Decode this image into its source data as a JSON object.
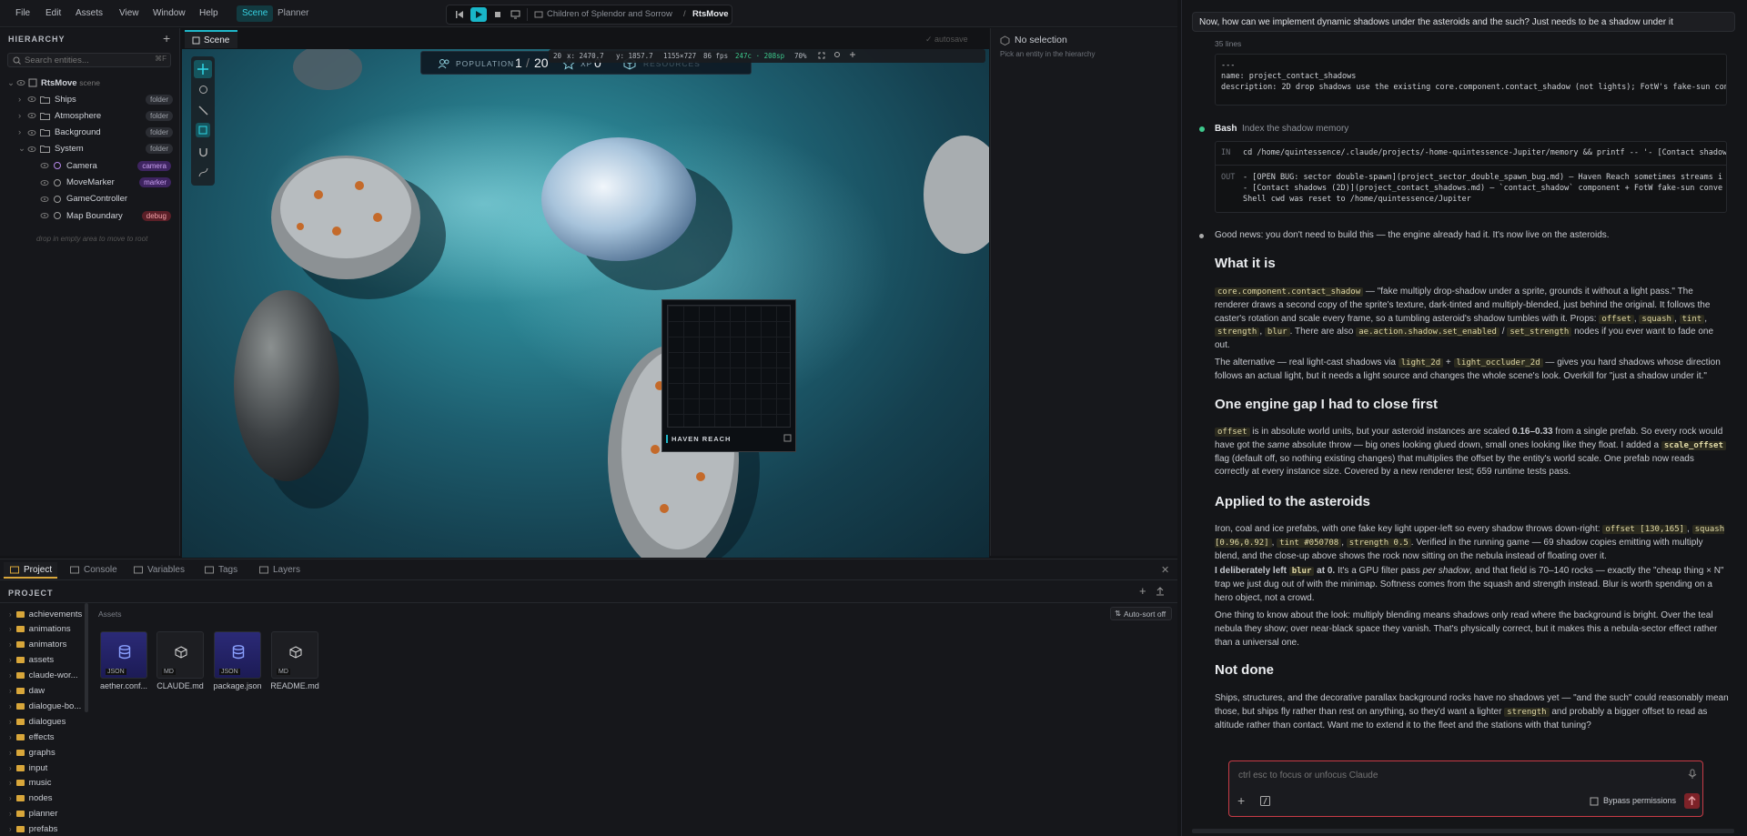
{
  "menubar": {
    "items": [
      "File",
      "Edit",
      "Assets",
      "View",
      "Window",
      "Help"
    ],
    "modes": [
      "Scene",
      "Planner"
    ],
    "breadcrumb_project": "Children of Splendor and Sorrow",
    "breadcrumb_sep": "/",
    "breadcrumb_scene": "RtsMove"
  },
  "hierarchy": {
    "title": "HIERARCHY",
    "search_placeholder": "Search entities...",
    "search_shortcut": "⌘F",
    "root": "RtsMove",
    "root_suffix": "scene",
    "items": [
      {
        "label": "Ships",
        "tag": "folder"
      },
      {
        "label": "Atmosphere",
        "tag": "folder"
      },
      {
        "label": "Background",
        "tag": "folder"
      },
      {
        "label": "System",
        "tag": "folder"
      },
      {
        "label": "Camera",
        "tag": "camera"
      },
      {
        "label": "MoveMarker",
        "tag": "marker"
      },
      {
        "label": "GameController",
        "tag": ""
      },
      {
        "label": "Map Boundary",
        "tag": "debug"
      }
    ],
    "drop_hint": "drop in empty area to move to root"
  },
  "scene": {
    "tab": "Scene",
    "autosave": "autosave",
    "hud": {
      "population_label": "POPULATION",
      "population_value": "1",
      "population_sep": "/",
      "population_max": "20",
      "xp_label": "XP",
      "xp_value": "0",
      "resources_label": "RESOURCES"
    },
    "stats": {
      "zoom_val": "20",
      "x": "x: 2470.7",
      "y": "y: 1857.7",
      "size": "1155×727",
      "fps": "86 fps",
      "mem": "247c · 208sp",
      "zoom": "70%"
    },
    "minimap_label": "HAVEN REACH"
  },
  "inspector": {
    "title": "No selection",
    "hint": "Pick an entity in the hierarchy"
  },
  "bottom": {
    "tabs": [
      "Project",
      "Console",
      "Variables",
      "Tags",
      "Layers"
    ],
    "project_title": "PROJECT",
    "assets_label": "Assets",
    "autosort": "Auto-sort off",
    "folders": [
      "achievements",
      "animations",
      "animators",
      "assets",
      "claude-wor...",
      "daw",
      "dialogue-bo...",
      "dialogues",
      "effects",
      "graphs",
      "input",
      "music",
      "nodes",
      "planner",
      "prefabs"
    ],
    "files": [
      {
        "name": "aether.conf...",
        "kind": "JSON"
      },
      {
        "name": "CLAUDE.md",
        "kind": "MD"
      },
      {
        "name": "package.json",
        "kind": "JSON"
      },
      {
        "name": "README.md",
        "kind": "MD"
      }
    ]
  },
  "chat": {
    "user_msg": "Now, how can we implement dynamic shadows under the asteroids and the such? Just needs to be a shadow under it",
    "lines_count": "35 lines",
    "file_block": [
      "---",
      "name: project_contact_shadows",
      "description: 2D drop shadows use the existing core.component.contact_shadow (not lights); FotW's fake-sun con"
    ],
    "bash_label": "Bash",
    "bash_desc": "Index the shadow memory",
    "bash_in": "cd /home/quintessence/.claude/projects/-home-quintessence-Jupiter/memory && printf -- '- [Contact shadow",
    "bash_out": [
      "- [OPEN BUG: sector double-spawn](project_sector_double_spawn_bug.md) — Haven Reach sometimes streams i",
      "- [Contact shadows (2D)](project_contact_shadows.md) — `contact_shadow` component + FotW fake-sun conve",
      "Shell cwd was reset to /home/quintessence/Jupiter"
    ],
    "intro": "Good news: you don't need to build this — the engine already had it. It's now live on the asteroids.",
    "h1": "What it is",
    "p1a": "core.component.contact_shadow",
    "p1b": " — \"fake multiply drop-shadow under a sprite, grounds it without a light pass.\" The renderer draws a second copy of the sprite's texture, dark-tinted and multiply-blended, just behind the original. It follows the caster's rotation and scale every frame, so a tumbling asteroid's shadow tumbles with it. Props: ",
    "props": [
      "offset",
      "squash",
      "tint",
      "strength",
      "blur"
    ],
    "p1c": ". There are also ",
    "p1d": "ae.action.shadow.set_enabled",
    "p1e": " / ",
    "p1f": "set_strength",
    "p1g": " nodes if you ever want to fade one out.",
    "p2a": "The alternative — real light-cast shadows via ",
    "p2b": "light_2d",
    "p2c": " + ",
    "p2d": "light_occluder_2d",
    "p2e": " — gives you hard shadows whose direction follows an actual light, but it needs a light source and changes the whole scene's look. Overkill for \"just a shadow under it.\"",
    "h2": "One engine gap I had to close first",
    "p3a": "offset",
    "p3b": " is in absolute world units, but your asteroid instances are scaled ",
    "p3c": "0.16–0.33",
    "p3d": " from a single prefab. So every rock would have got the ",
    "p3e": "same",
    "p3f": " absolute throw — big ones looking glued down, small ones looking like they float. I added a ",
    "p3g": "scale_offset",
    "p3h": " flag (default off, so nothing existing changes) that multiplies the offset by the entity's world scale. One prefab now reads correctly at every instance size. Covered by a new renderer test; 659 runtime tests pass.",
    "h3": "Applied to the asteroids",
    "p4a": "Iron, coal and ice prefabs, with one fake key light upper-left so every shadow throws down-right: ",
    "p4b": "offset [130,165]",
    "p4c": "squash [0.96,0.92]",
    "p4d": "tint #050708",
    "p4e": "strength 0.5",
    "p4f": ". Verified in the running game — 69 shadow copies emitting with multiply blend, and the close-up above shows the rock now sitting on the nebula instead of floating over it.",
    "p5a": "I deliberately left ",
    "p5b": "blur",
    "p5c": " at 0.",
    "p5d": " It's a GPU filter pass ",
    "p5e": "per shadow",
    "p5f": ", and that field is 70–140 rocks — exactly the \"cheap thing × N\" trap we just dug out of with the minimap. Softness comes from the squash and strength instead. Blur is worth spending on a hero object, not a crowd.",
    "p6": "One thing to know about the look: multiply blending means shadows only read where the background is bright. Over the teal nebula they show; over near-black space they vanish. That's physically correct, but it makes this a nebula-sector effect rather than a universal one.",
    "h4": "Not done",
    "p7a": "Ships, structures, and the decorative parallax background rocks have no shadows yet — \"and the such\" could reasonably mean those, but ships fly rather than rest on anything, so they'd want a lighter ",
    "p7b": "strength",
    "p7c": " and probably a bigger offset to read as altitude rather than contact. Want me to extend it to the fleet and the stations with that tuning?",
    "input_placeholder": "ctrl esc to focus or unfocus Claude",
    "bypass": "Bypass permissions"
  },
  "colors": {
    "accent": "#1fb7c9",
    "danger": "#c83b46"
  }
}
